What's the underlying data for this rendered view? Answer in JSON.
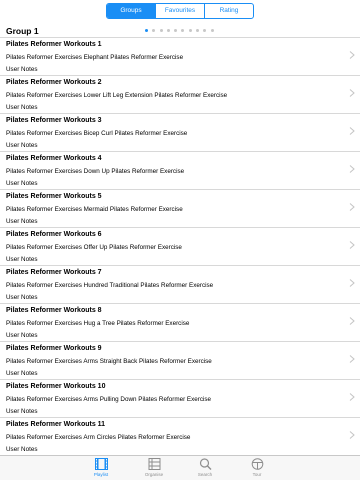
{
  "segments": [
    "Groups",
    "Favourites",
    "Rating"
  ],
  "active_segment": 0,
  "group_title": "Group 1",
  "page_dots": {
    "count": 10,
    "active": 0
  },
  "rows": [
    {
      "title": "Pilates Reformer Workouts 1",
      "subtitle": "Pilates Reformer Exercises  Elephant Pilates Reformer Exercise",
      "notes": "User Notes"
    },
    {
      "title": "Pilates Reformer Workouts 2",
      "subtitle": "Pilates Reformer Exercises  Lower  Lift Leg Extension Pilates Reformer Exercise",
      "notes": "User Notes"
    },
    {
      "title": "Pilates Reformer Workouts 3",
      "subtitle": "Pilates Reformer Exercises  Bicep Curl Pilates Reformer Exercise",
      "notes": "User Notes"
    },
    {
      "title": "Pilates Reformer Workouts 4",
      "subtitle": "Pilates Reformer Exercises  Down  Up Pilates Reformer Exercise",
      "notes": "User Notes"
    },
    {
      "title": "Pilates Reformer Workouts 5",
      "subtitle": "Pilates Reformer Exercises  Mermaid Pilates Reformer Exercise",
      "notes": "User Notes"
    },
    {
      "title": "Pilates Reformer Workouts 6",
      "subtitle": "Pilates Reformer Exercises  Offer Up Pilates Reformer Exercise",
      "notes": "User Notes"
    },
    {
      "title": "Pilates Reformer Workouts 7",
      "subtitle": "Pilates Reformer Exercises  Hundred Traditional Pilates Reformer Exercise",
      "notes": "User Notes"
    },
    {
      "title": "Pilates Reformer Workouts 8",
      "subtitle": "Pilates Reformer Exercises  Hug a Tree Pilates Reformer Exercise",
      "notes": "User Notes"
    },
    {
      "title": "Pilates Reformer Workouts 9",
      "subtitle": "Pilates Reformer Exercises  Arms Straight Back Pilates Reformer Exercise",
      "notes": "User Notes"
    },
    {
      "title": "Pilates Reformer Workouts 10",
      "subtitle": "Pilates Reformer Exercises  Arms Pulling Down Pilates Reformer Exercise",
      "notes": "User Notes"
    },
    {
      "title": "Pilates Reformer Workouts 11",
      "subtitle": "Pilates Reformer Exercises  Arm Circles Pilates Reformer Exercise",
      "notes": "User Notes"
    }
  ],
  "tabs": [
    {
      "label": "Playlist",
      "icon": "film-icon"
    },
    {
      "label": "Organise",
      "icon": "grid-icon"
    },
    {
      "label": "Search",
      "icon": "search-icon"
    },
    {
      "label": "Tour",
      "icon": "tour-icon"
    }
  ],
  "active_tab": 0,
  "colors": {
    "accent": "#1a8ef5",
    "separator": "#d8d8d8",
    "tabbar": "#f7f7f7"
  }
}
